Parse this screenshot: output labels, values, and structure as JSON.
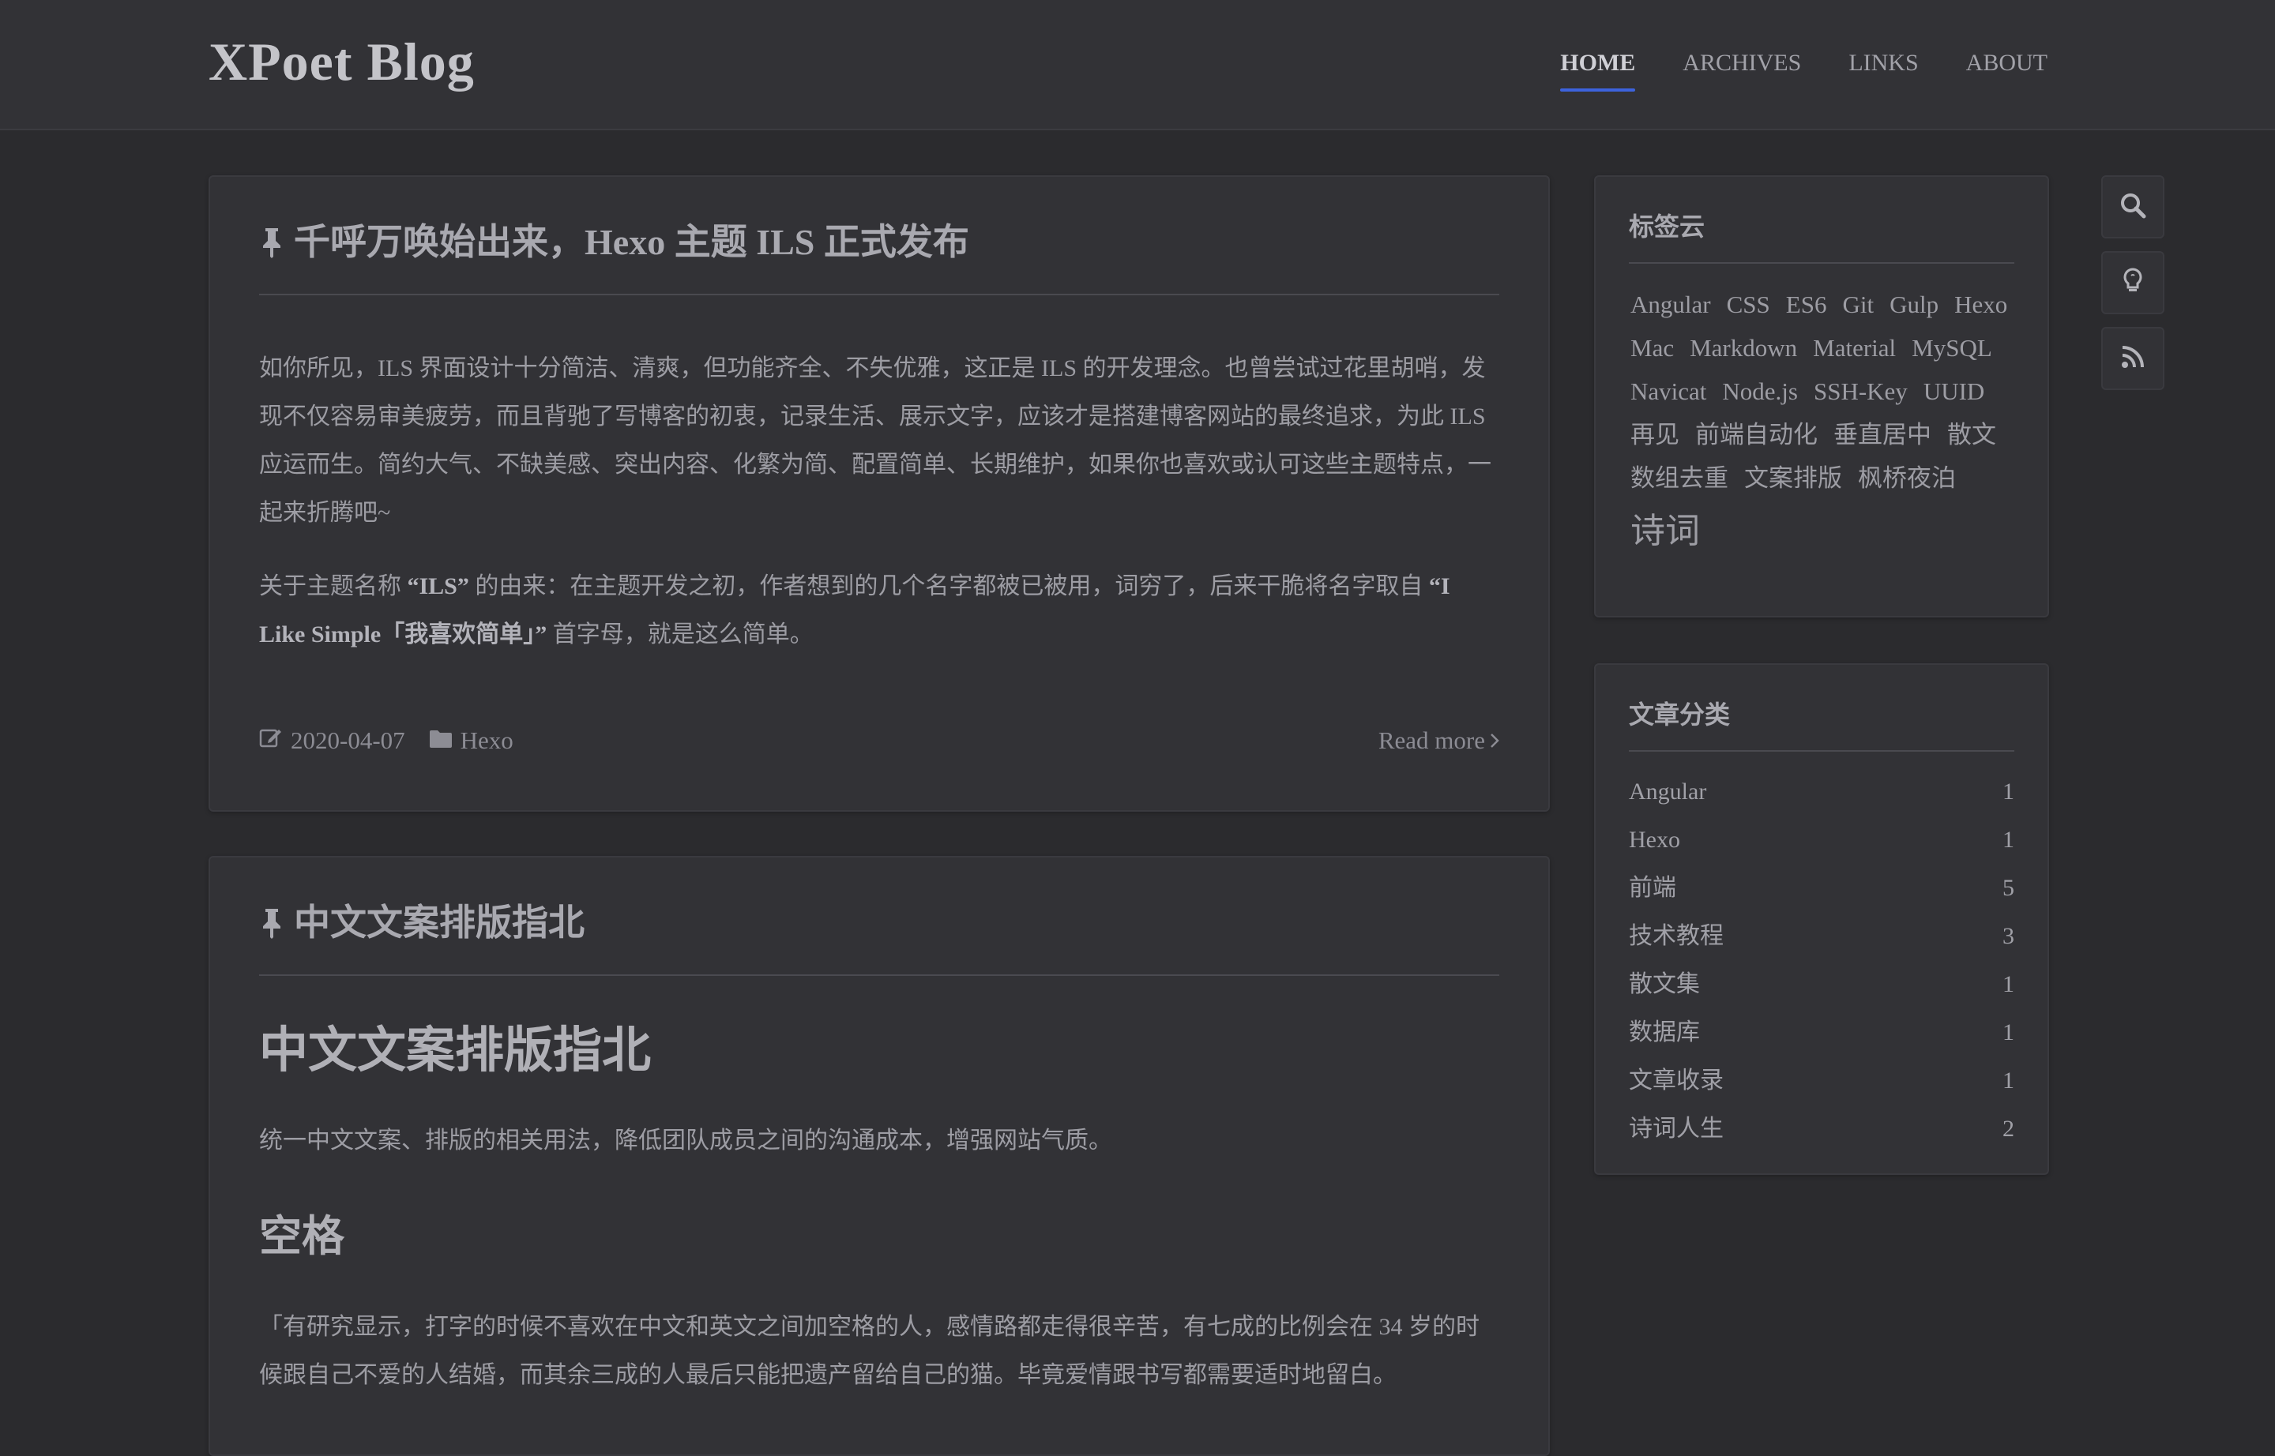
{
  "header": {
    "logo": "XPoet Blog",
    "nav": [
      {
        "label": "HOME",
        "active": true
      },
      {
        "label": "ARCHIVES",
        "active": false
      },
      {
        "label": "LINKS",
        "active": false
      },
      {
        "label": "ABOUT",
        "active": false
      }
    ]
  },
  "posts": [
    {
      "title": "千呼万唤始出来，Hexo 主题 ILS 正式发布",
      "paragraphs": [
        "如你所见，ILS 界面设计十分简洁、清爽，但功能齐全、不失优雅，这正是 ILS 的开发理念。也曾尝试过花里胡哨，发现不仅容易审美疲劳，而且背驰了写博客的初衷，记录生活、展示文字，应该才是搭建博客网站的最终追求，为此 ILS 应运而生。简约大气、不缺美感、突出内容、化繁为简、配置简单、长期维护，如果你也喜欢或认可这些主题特点，一起来折腾吧~"
      ],
      "name_para": {
        "prefix": "关于主题名称 ",
        "bold1": "“ILS”",
        "middle": " 的由来：在主题开发之初，作者想到的几个名字都被已被用，词穷了，后来干脆将名字取自 ",
        "bold2": "“I Like Simple「我喜欢简单」”",
        "suffix": " 首字母，就是这么简单。"
      },
      "date": "2020-04-07",
      "category": "Hexo",
      "read_more": "Read more"
    },
    {
      "title": "中文文案排版指北",
      "h1": "中文文案排版指北",
      "intro": "统一中文文案、排版的相关用法，降低团队成员之间的沟通成本，增强网站气质。",
      "h2": "空格",
      "quote": "「有研究显示，打字的时候不喜欢在中文和英文之间加空格的人，感情路都走得很辛苦，有七成的比例会在 34 岁的时候跟自己不爱的人结婚，而其余三成的人最后只能把遗产留给自己的猫。毕竟爱情跟书写都需要适时地留白。"
    }
  ],
  "sidebar": {
    "tagcloud_title": "标签云",
    "tags": [
      "Angular",
      "CSS",
      "ES6",
      "Git",
      "Gulp",
      "Hexo",
      "Mac",
      "Markdown",
      "Material",
      "MySQL",
      "Navicat",
      "Node.js",
      "SSH-Key",
      "UUID",
      "再见",
      "前端自动化",
      "垂直居中",
      "散文",
      "数组去重",
      "文案排版",
      "枫桥夜泊",
      "诗词"
    ],
    "big_tag": "诗词",
    "categories_title": "文章分类",
    "categories": [
      {
        "name": "Angular",
        "count": "1"
      },
      {
        "name": "Hexo",
        "count": "1"
      },
      {
        "name": "前端",
        "count": "5"
      },
      {
        "name": "技术教程",
        "count": "3"
      },
      {
        "name": "散文集",
        "count": "1"
      },
      {
        "name": "数据库",
        "count": "1"
      },
      {
        "name": "文章收录",
        "count": "1"
      },
      {
        "name": "诗词人生",
        "count": "2"
      }
    ]
  },
  "tools": {
    "search": "search-icon",
    "theme": "lightbulb-icon",
    "rss": "rss-icon"
  },
  "colors": {
    "background": "#2b2b2e",
    "card": "#323236",
    "accent": "#3d63dd"
  }
}
